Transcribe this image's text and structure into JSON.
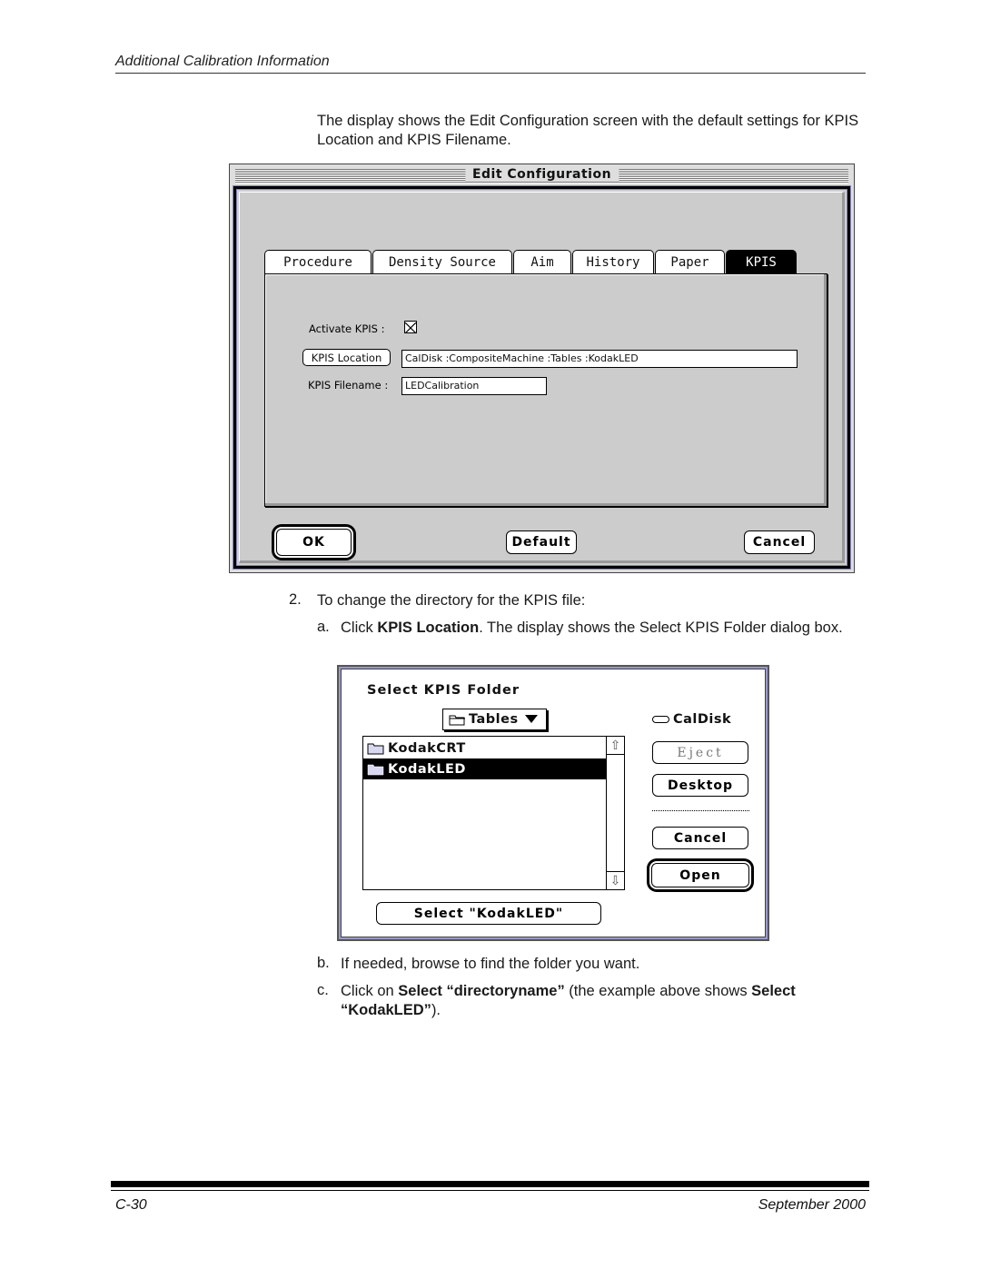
{
  "page": {
    "running_head": "Additional Calibration Information",
    "intro": "The display shows the Edit Configuration screen with the default settings for KPIS Location and KPIS Filename.",
    "step2": {
      "number": "2.",
      "text": "To change the directory for the KPIS file:"
    },
    "step_a": {
      "marker": "a.",
      "pre": "Click ",
      "bold": "KPIS Location",
      "post": ". The display shows the Select KPIS Folder dialog box."
    },
    "step_b": {
      "marker": "b.",
      "text": "If needed, browse to find the folder you want."
    },
    "step_c": {
      "marker": "c.",
      "pre": "Click on ",
      "bold1": "Select “directoryname”",
      "mid": " (the example above shows ",
      "bold2": "Select “KodakLED”",
      "post": ")."
    },
    "footer": {
      "page_number": "C-30",
      "date": "September 2000"
    }
  },
  "edit_config": {
    "title": "Edit Configuration",
    "tabs": [
      {
        "label": "Procedure",
        "active": false
      },
      {
        "label": "Density Source",
        "active": false
      },
      {
        "label": "Aim",
        "active": false
      },
      {
        "label": "History",
        "active": false
      },
      {
        "label": "Paper",
        "active": false
      },
      {
        "label": "KPIS",
        "active": true
      }
    ],
    "activate_kpis": {
      "label": "Activate KPIS :",
      "checked": true
    },
    "kpis_location": {
      "button_label": "KPIS Location",
      "value": "CalDisk :CompositeMachine :Tables :KodakLED"
    },
    "kpis_filename": {
      "label": "KPIS Filename :",
      "value": "LEDCalibration"
    },
    "buttons": {
      "ok": "OK",
      "default": "Default",
      "cancel": "Cancel"
    }
  },
  "select_folder": {
    "title": "Select KPIS Folder",
    "current_folder": "Tables",
    "disk_name": "CalDisk",
    "items": [
      {
        "name": "KodakCRT",
        "selected": false,
        "icon": "folder-icon"
      },
      {
        "name": "KodakLED",
        "selected": true,
        "icon": "folder-icon"
      }
    ],
    "buttons": {
      "eject": "Eject",
      "desktop": "Desktop",
      "cancel": "Cancel",
      "open": "Open",
      "select": "Select \"KodakLED\""
    }
  }
}
